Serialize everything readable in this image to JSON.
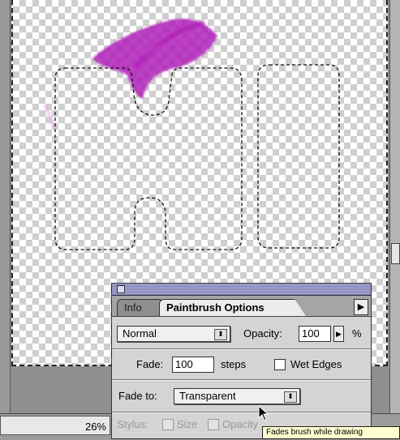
{
  "status": {
    "zoom": "26%"
  },
  "palette": {
    "tabs": {
      "info": "Info",
      "active": "Paintbrush Options"
    },
    "blend_mode": {
      "value": "Normal"
    },
    "opacity": {
      "label": "Opacity:",
      "value": "100",
      "unit": "%"
    },
    "fade": {
      "label": "Fade:",
      "value": "100",
      "unit": "steps"
    },
    "wet_edges": {
      "label": "Wet Edges",
      "checked": false
    },
    "fade_to": {
      "label": "Fade to:",
      "value": "Transparent"
    },
    "stylus": {
      "label": "Stylus:",
      "size_label": "Size",
      "opacity_label": "Opacity"
    }
  },
  "tooltip": {
    "text": "Fades brush while drawing"
  },
  "colors": {
    "brush_stroke": "#b020b8",
    "palette_bg": "#d4d4d4",
    "tooltip_bg": "#ffffd0"
  },
  "icons": [
    "close-box-icon",
    "palette-menu-arrow-icon",
    "popup-arrows-icon",
    "arrow-cursor-icon"
  ]
}
